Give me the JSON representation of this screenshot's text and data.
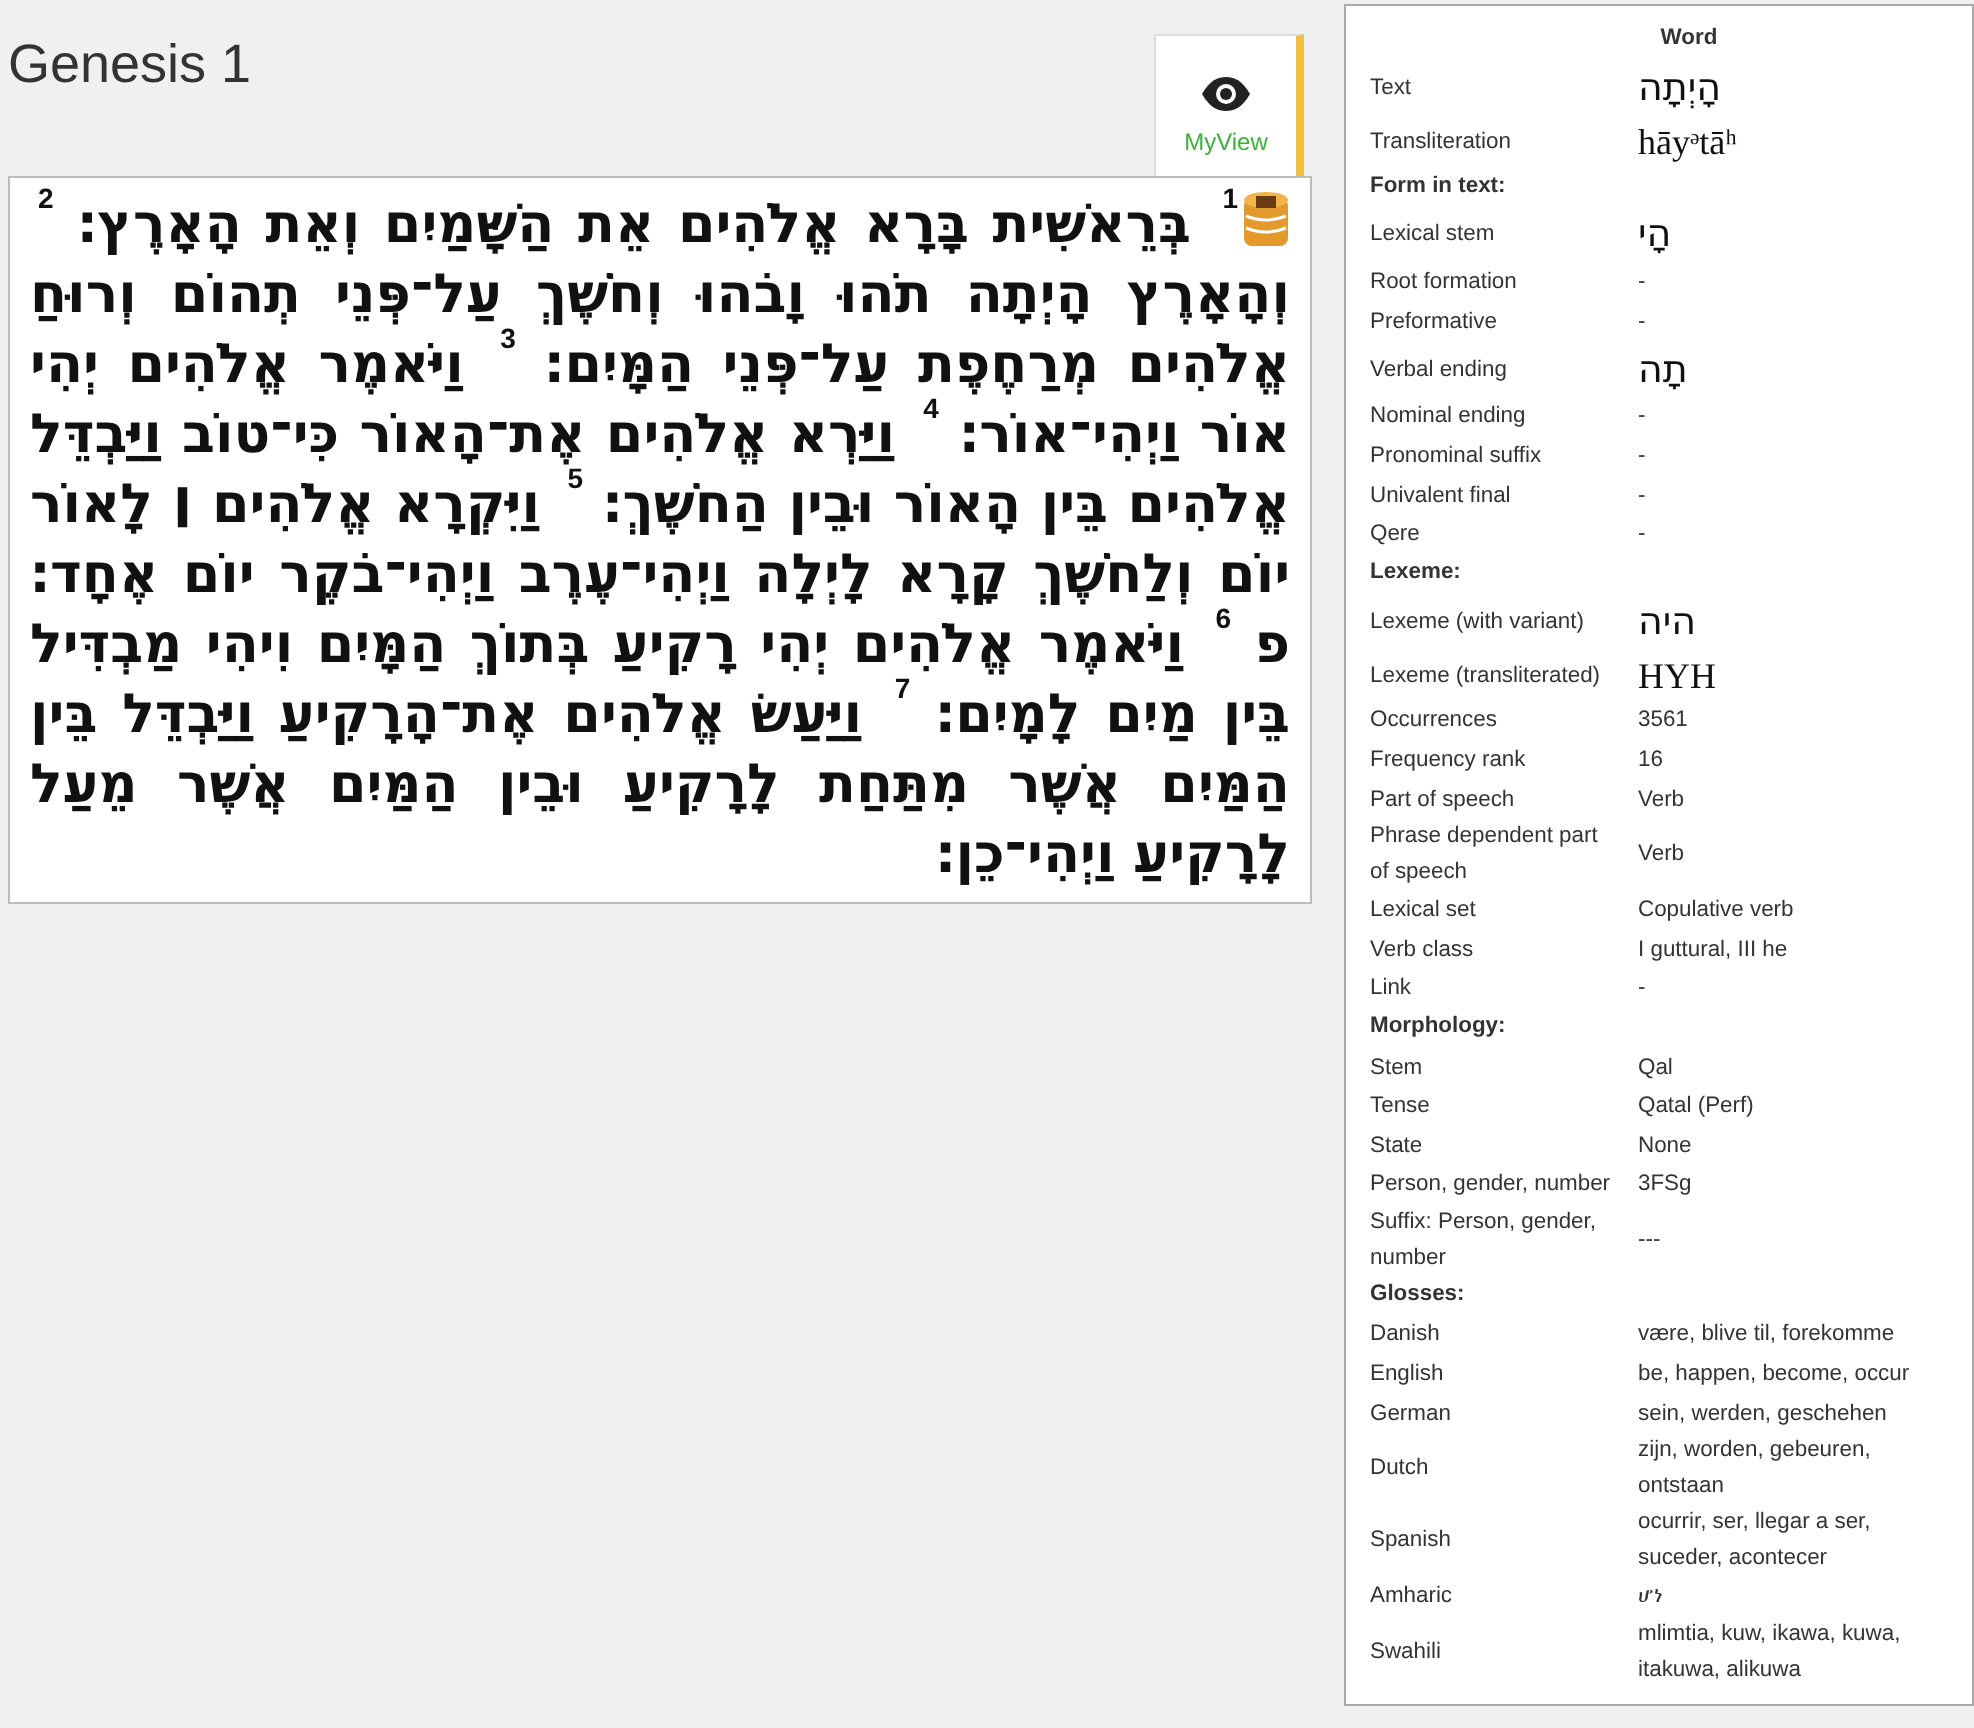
{
  "title": "Genesis 1",
  "myview": {
    "label": "MyView"
  },
  "verses": [
    {
      "number": "1",
      "text": "בְּרֵאשִׁית בָּרָא אֱלֹהִים אֵת הַשָּׁמַיִם וְאֵת הָאָרֶץ׃"
    },
    {
      "number": "2",
      "text": "וְהָאָרֶץ הָיְתָה תֹהוּ וָבֹהוּ וְחֹשֶׁךְ עַל־פְּנֵי תְהוֹם וְרוּחַ אֱלֹהִים מְרַחֶפֶת עַל־פְּנֵי הַמָּיִם׃"
    },
    {
      "number": "3",
      "text": "וַיֹּאמֶר אֱלֹהִים יְהִי אוֹר וַיְהִי־אוֹר׃"
    },
    {
      "number": "4",
      "text": "וַיַּרְא אֱלֹהִים אֶת־הָאוֹר כִּי־טוֹב וַיַּבְדֵּל אֱלֹהִים בֵּין הָאוֹר וּבֵין הַחֹשֶׁךְ׃"
    },
    {
      "number": "5",
      "text": "וַיִּקְרָא אֱלֹהִים ׀ לָאוֹר יוֹם וְלַחֹשֶׁךְ קָרָא לָיְלָה וַיְהִי־עֶרֶב וַיְהִי־בֹקֶר יוֹם אֶחָד׃ פ"
    },
    {
      "number": "6",
      "text": "וַיֹּאמֶר אֱלֹהִים יְהִי רָקִיעַ בְּתוֹךְ הַמָּיִם וִיהִי מַבְדִּיל בֵּין מַיִם לָמָיִם׃"
    },
    {
      "number": "7",
      "text": "וַיַּעַשׂ אֱלֹהִים אֶת־הָרָקִיעַ וַיַּבְדֵּל בֵּין הַמַּיִם אֲשֶׁר מִתַּחַת לָרָקִיעַ וּבֵין הַמַּיִם אֲשֶׁר מֵעַל לָרָקִיעַ וַיְהִי־כֵן׃"
    }
  ],
  "word_panel": {
    "heading": "Word",
    "rows": [
      {
        "kind": "hebrew",
        "label": "Text",
        "value": "הָיְתָה"
      },
      {
        "kind": "translit",
        "label": "Transliteration",
        "value": "hāyᵊtāʰ"
      },
      {
        "kind": "section",
        "label": "Form in text:"
      },
      {
        "kind": "hebrew",
        "label": "Lexical stem",
        "value": "הָי"
      },
      {
        "kind": "plain",
        "label": "Root formation",
        "value": "-"
      },
      {
        "kind": "plain",
        "label": "Preformative",
        "value": "-"
      },
      {
        "kind": "hebrew",
        "label": "Verbal ending",
        "value": "תָה"
      },
      {
        "kind": "plain",
        "label": "Nominal ending",
        "value": "-"
      },
      {
        "kind": "plain",
        "label": "Pronominal suffix",
        "value": "-"
      },
      {
        "kind": "plain",
        "label": "Univalent final",
        "value": "-"
      },
      {
        "kind": "plain",
        "label": "Qere",
        "value": "-"
      },
      {
        "kind": "section",
        "label": "Lexeme:"
      },
      {
        "kind": "hebrew",
        "label": "Lexeme (with variant)",
        "value": "היה"
      },
      {
        "kind": "translit",
        "label": "Lexeme (transliterated)",
        "value": "HYH"
      },
      {
        "kind": "plain",
        "label": "Occurrences",
        "value": "3561"
      },
      {
        "kind": "plain",
        "label": "Frequency rank",
        "value": "16"
      },
      {
        "kind": "plain",
        "label": "Part of speech",
        "value": "Verb"
      },
      {
        "kind": "plain",
        "label": "Phrase dependent part of speech",
        "value": "Verb"
      },
      {
        "kind": "plain",
        "label": "Lexical set",
        "value": "Copulative verb"
      },
      {
        "kind": "plain",
        "label": "Verb class",
        "value": "I guttural, III he"
      },
      {
        "kind": "plain",
        "label": "Link",
        "value": "-"
      },
      {
        "kind": "section",
        "label": "Morphology:"
      },
      {
        "kind": "plain",
        "label": "Stem",
        "value": "Qal"
      },
      {
        "kind": "plain",
        "label": "Tense",
        "value": "Qatal (Perf)"
      },
      {
        "kind": "plain",
        "label": "State",
        "value": "None"
      },
      {
        "kind": "plain",
        "label": "Person, gender, number",
        "value": "3FSg"
      },
      {
        "kind": "plain",
        "label": "Suffix: Person, gender, number",
        "value": "---"
      },
      {
        "kind": "section",
        "label": "Glosses:"
      },
      {
        "kind": "plain",
        "label": "Danish",
        "value": "være, blive til, forekomme"
      },
      {
        "kind": "plain",
        "label": "English",
        "value": "be, happen, become, occur"
      },
      {
        "kind": "plain",
        "label": "German",
        "value": "sein, werden, geschehen"
      },
      {
        "kind": "plain",
        "label": "Dutch",
        "value": "zijn, worden, gebeuren, ontstaan"
      },
      {
        "kind": "plain",
        "label": "Spanish",
        "value": "ocurrir, ser, llegar a ser, suceder, acontecer"
      },
      {
        "kind": "plain",
        "label": "Amharic",
        "value": "ሆነ"
      },
      {
        "kind": "plain",
        "label": "Swahili",
        "value": "mlimtia, kuw, ikawa, kuwa, itakuwa, alikuwa"
      }
    ]
  }
}
